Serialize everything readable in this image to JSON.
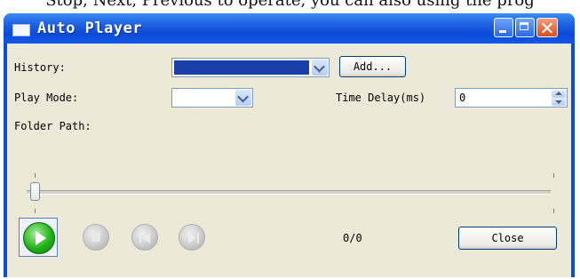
{
  "caption_above": "Stop, Next, Previous to operate, you can also using the prog",
  "window": {
    "title": "Auto Player"
  },
  "form": {
    "history_label": "History:",
    "add_label": "Add...",
    "play_mode_label": "Play Mode:",
    "play_mode_value": "",
    "time_delay_label": "Time Delay(ms)",
    "time_delay_value": "0",
    "folder_path_label": "Folder Path:"
  },
  "slider": {
    "position": 0
  },
  "controls": {
    "counter": "0/0",
    "close_label": "Close"
  },
  "colors": {
    "titlebar": "#0a4fd8",
    "history_selection": "#1a3fa8",
    "play_green": "#22b318",
    "window_face": "#ece9d8"
  },
  "icons": [
    "play-icon",
    "stop-icon",
    "previous-icon",
    "next-icon",
    "minimize-icon",
    "maximize-icon",
    "close-window-icon"
  ]
}
